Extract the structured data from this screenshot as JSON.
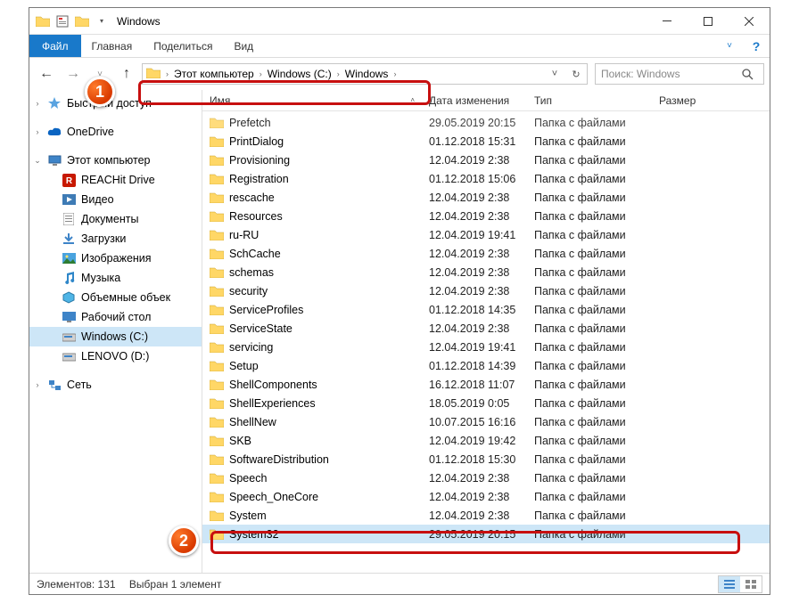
{
  "window": {
    "title": "Windows"
  },
  "ribbon": {
    "file": "Файл",
    "tabs": [
      "Главная",
      "Поделиться",
      "Вид"
    ]
  },
  "breadcrumbs": [
    "Этот компьютер",
    "Windows (C:)",
    "Windows"
  ],
  "search": {
    "placeholder": "Поиск: Windows"
  },
  "columns": {
    "name": "Имя",
    "date": "Дата изменения",
    "type": "Тип",
    "size": "Размер"
  },
  "type_folder": "Папка с файлами",
  "sidebar": {
    "quick": "Быстрый доступ",
    "onedrive": "OneDrive",
    "thispc": "Этот компьютер",
    "children": [
      {
        "label": "REACHit Drive",
        "icon": "reachit"
      },
      {
        "label": "Видео",
        "icon": "video"
      },
      {
        "label": "Документы",
        "icon": "docs"
      },
      {
        "label": "Загрузки",
        "icon": "downloads"
      },
      {
        "label": "Изображения",
        "icon": "pictures"
      },
      {
        "label": "Музыка",
        "icon": "music"
      },
      {
        "label": "Объемные объек",
        "icon": "3d"
      },
      {
        "label": "Рабочий стол",
        "icon": "desktop"
      },
      {
        "label": "Windows (C:)",
        "icon": "disk",
        "selected": true
      },
      {
        "label": "LENOVO (D:)",
        "icon": "disk"
      }
    ],
    "network": "Сеть"
  },
  "files": [
    {
      "name": "Prefetch",
      "date": "29.05.2019 20:15"
    },
    {
      "name": "PrintDialog",
      "date": "01.12.2018 15:31"
    },
    {
      "name": "Provisioning",
      "date": "12.04.2019 2:38"
    },
    {
      "name": "Registration",
      "date": "01.12.2018 15:06"
    },
    {
      "name": "rescache",
      "date": "12.04.2019 2:38"
    },
    {
      "name": "Resources",
      "date": "12.04.2019 2:38"
    },
    {
      "name": "ru-RU",
      "date": "12.04.2019 19:41"
    },
    {
      "name": "SchCache",
      "date": "12.04.2019 2:38"
    },
    {
      "name": "schemas",
      "date": "12.04.2019 2:38"
    },
    {
      "name": "security",
      "date": "12.04.2019 2:38"
    },
    {
      "name": "ServiceProfiles",
      "date": "01.12.2018 14:35"
    },
    {
      "name": "ServiceState",
      "date": "12.04.2019 2:38"
    },
    {
      "name": "servicing",
      "date": "12.04.2019 19:41"
    },
    {
      "name": "Setup",
      "date": "01.12.2018 14:39"
    },
    {
      "name": "ShellComponents",
      "date": "16.12.2018 11:07"
    },
    {
      "name": "ShellExperiences",
      "date": "18.05.2019 0:05"
    },
    {
      "name": "ShellNew",
      "date": "10.07.2015 16:16"
    },
    {
      "name": "SKB",
      "date": "12.04.2019 19:42"
    },
    {
      "name": "SoftwareDistribution",
      "date": "01.12.2018 15:30"
    },
    {
      "name": "Speech",
      "date": "12.04.2019 2:38"
    },
    {
      "name": "Speech_OneCore",
      "date": "12.04.2019 2:38"
    },
    {
      "name": "System",
      "date": "12.04.2019 2:38"
    },
    {
      "name": "System32",
      "date": "29.05.2019 20:15",
      "selected": true
    }
  ],
  "status": {
    "count_label": "Элементов:",
    "count": "131",
    "selection": "Выбран 1 элемент"
  }
}
